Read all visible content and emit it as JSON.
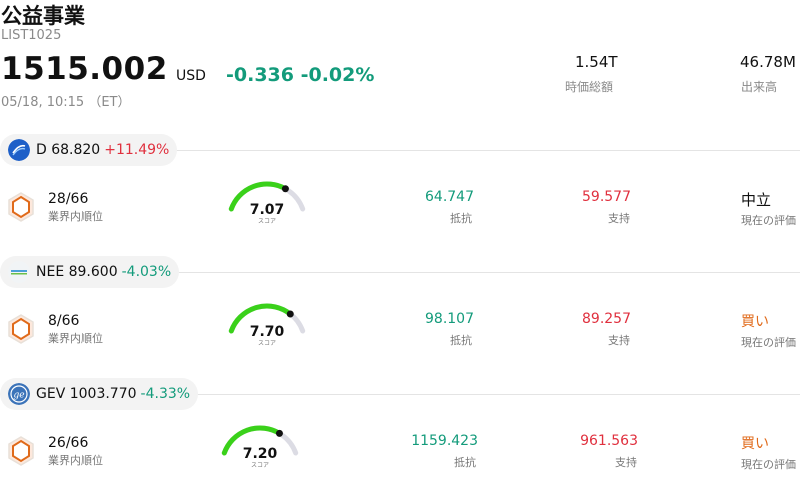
{
  "header": {
    "title": "公益事業",
    "code": "LIST1025",
    "price": "1515.002",
    "currency": "USD",
    "change": "-0.336 -0.02%",
    "time": "05/18, 10:15 （ET）",
    "market_cap_value": "1.54T",
    "market_cap_label": "時価総額",
    "volume_value": "46.78M",
    "volume_label": "出来高"
  },
  "labels": {
    "rank": "業界内順位",
    "score": "スコア",
    "resistance": "抵抗",
    "support": "支持",
    "rating": "現在の評価"
  },
  "stocks": [
    {
      "ticker_price": "D 68.820",
      "change": "+11.49%",
      "rank": "28/66",
      "score": "7.07",
      "score_fraction": 0.707,
      "resistance": "64.747",
      "support": "59.577",
      "rating": "中立"
    },
    {
      "ticker_price": "NEE 89.600",
      "change": "-4.03%",
      "rank": "8/66",
      "score": "7.70",
      "score_fraction": 0.77,
      "resistance": "98.107",
      "support": "89.257",
      "rating": "買い"
    },
    {
      "ticker_price": "GEV 1003.770",
      "change": "-4.33%",
      "rank": "26/66",
      "score": "7.20",
      "score_fraction": 0.72,
      "resistance": "1159.423",
      "support": "961.563",
      "rating": "買い"
    }
  ],
  "colors": {
    "up": "#e0303e",
    "down": "#139b7b",
    "gauge_fill": "#3ad11a",
    "gauge_track": "#dcdce4",
    "buy": "#e06a1a"
  },
  "icons": {
    "rank": "rank-hexagon-icon",
    "logo_d": "dominion-logo-icon",
    "logo_nee": "nextera-logo-icon",
    "logo_gev": "ge-logo-icon"
  }
}
